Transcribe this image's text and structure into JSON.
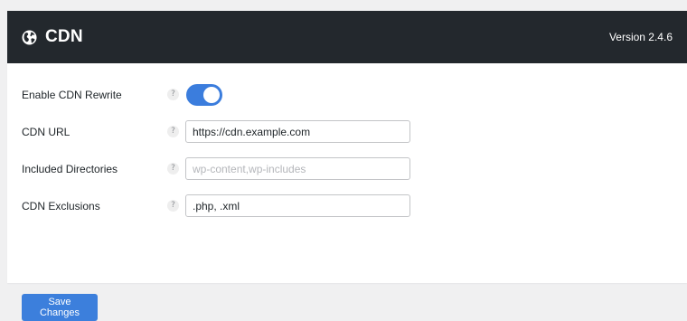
{
  "header": {
    "title": "CDN",
    "version": "Version 2.4.6",
    "icon": "globe-icon"
  },
  "fields": {
    "rewrite": {
      "label": "Enable CDN Rewrite",
      "help": "?",
      "enabled": true
    },
    "cdn_url": {
      "label": "CDN URL",
      "help": "?",
      "value": "https://cdn.example.com",
      "placeholder": ""
    },
    "dirs": {
      "label": "Included Directories",
      "help": "?",
      "value": "",
      "placeholder": "wp-content,wp-includes"
    },
    "exclusions": {
      "label": "CDN Exclusions",
      "help": "?",
      "value": ".php, .xml",
      "placeholder": ""
    }
  },
  "actions": {
    "save_label": "Save Changes"
  },
  "colors": {
    "header_bg": "#23282d",
    "accent": "#3b7ddd",
    "page_bg": "#f0f0f1"
  }
}
